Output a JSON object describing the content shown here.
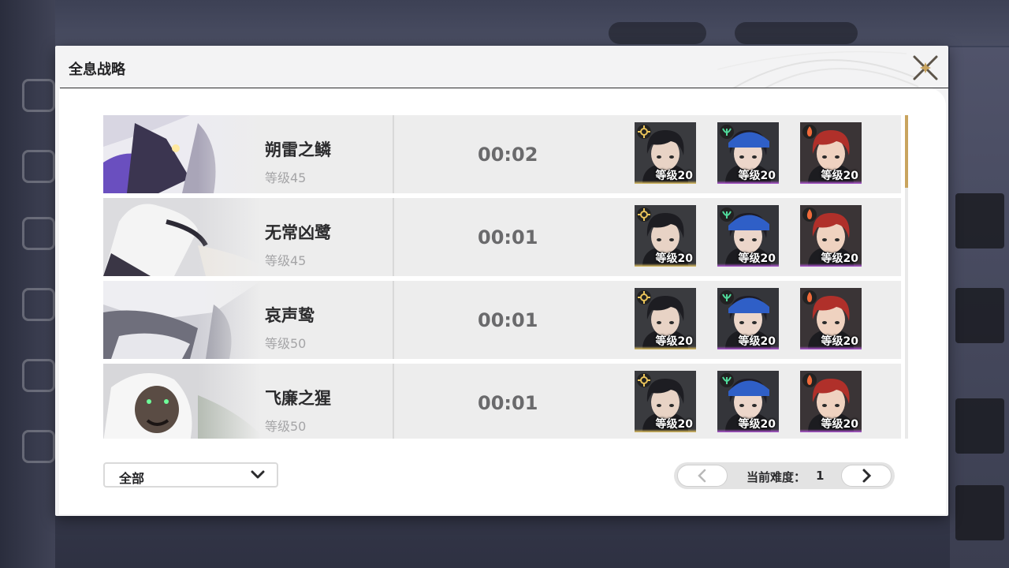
{
  "modal": {
    "title": "全息战略"
  },
  "bosses": [
    {
      "name": "朔雷之鳞",
      "level": "等级45",
      "time": "00:02"
    },
    {
      "name": "无常凶鹭",
      "level": "等级45",
      "time": "00:01"
    },
    {
      "name": "哀声鸷",
      "level": "等级50",
      "time": "00:01"
    },
    {
      "name": "飞廉之猩",
      "level": "等级50",
      "time": "00:01"
    }
  ],
  "team": [
    {
      "icon": "electro-element-icon",
      "level": "等级20",
      "rarity_color": "#e6c766"
    },
    {
      "icon": "aero-element-icon",
      "level": "等级20",
      "rarity_color": "#b45ad8"
    },
    {
      "icon": "fusion-element-icon",
      "level": "等级20",
      "rarity_color": "#b45ad8"
    }
  ],
  "filter": {
    "label": "全部"
  },
  "pager": {
    "label": "当前难度：",
    "value": "1",
    "prev": "❮",
    "next": "❯"
  },
  "colors": {
    "accent_gold": "#c9a45e",
    "five_star": "#e6c766",
    "four_star": "#b45ad8"
  }
}
